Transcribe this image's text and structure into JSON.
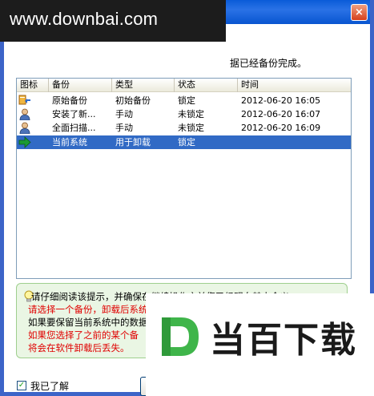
{
  "window": {
    "close_glyph": "×",
    "intro_text": "据已经备份完成。"
  },
  "watermark_top": "www.downbai.com",
  "table": {
    "columns": [
      "图标",
      "备份",
      "类型",
      "状态",
      "时间"
    ],
    "rows": [
      {
        "icon": "arrow-restore-icon",
        "name": "原始备份",
        "type": "初始备份",
        "status": "锁定",
        "time": "2012-06-20 16:05"
      },
      {
        "icon": "user-icon",
        "name": "安装了新...",
        "type": "手动",
        "status": "未锁定",
        "time": "2012-06-20 16:07"
      },
      {
        "icon": "user-icon",
        "name": "全面扫描...",
        "type": "手动",
        "status": "未锁定",
        "time": "2012-06-20 16:09"
      },
      {
        "icon": "green-arrow-icon",
        "name": "当前系统",
        "type": "用于卸载",
        "status": "锁定",
        "time": ""
      }
    ]
  },
  "notice": {
    "line1": "请仔细阅读该提示，并确保在继续操作之前您已经明白其中含义。",
    "line2": "请选择一个备份，卸载后系统将被保留在该备份所在的状态。",
    "line3": "如果要保留当前系统中的数据，请选择“当前系统”（最后一个备份）",
    "line4": "如果您选择了之前的某个备",
    "line5": "将会在软件卸载后丢失。"
  },
  "footer": {
    "checkbox_label": "我已了解",
    "checkbox_mark": "✓"
  },
  "brand_watermark": "当百下载",
  "colors": {
    "selection": "#316ac5",
    "notice_bg": "#eaf6e4",
    "notice_red": "#e00000",
    "title_blue": "#0a5bd8"
  }
}
